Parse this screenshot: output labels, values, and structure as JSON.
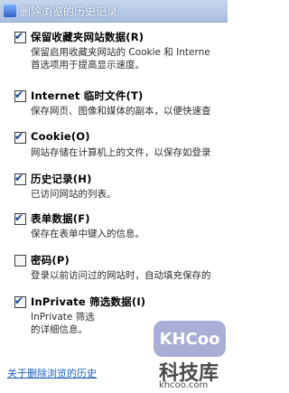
{
  "window": {
    "title": "删除浏览的历史记录"
  },
  "items": [
    {
      "label": "保留收藏夹网站数据(R)",
      "checked": true,
      "description": [
        "保留启用收藏夹网站的 Cookie 和 Interne",
        "首选项用于提高显示速度。"
      ]
    },
    {
      "label": "Internet 临时文件(T)",
      "checked": true,
      "description": [
        "保存网页、图像和媒体的副本，以便快速查"
      ]
    },
    {
      "label": "Cookie(O)",
      "checked": true,
      "description": [
        "网站存储在计算机上的文件，以保存如登录"
      ]
    },
    {
      "label": "历史记录(H)",
      "checked": true,
      "description": [
        "已访问网站的列表。"
      ]
    },
    {
      "label": "表单数据(F)",
      "checked": true,
      "description": [
        "保存在表单中键入的信息。"
      ]
    },
    {
      "label": "密码(P)",
      "checked": false,
      "description": [
        "登录以前访问过的网站时，自动填充保存的"
      ]
    },
    {
      "label": "InPrivate 筛选数据(I)",
      "checked": true,
      "description": [
        "InPrivate 筛选",
        "的详细信息。"
      ]
    }
  ],
  "link": {
    "text": "关于删除浏览的历史"
  },
  "watermark": {
    "logo_text": "KHCoo",
    "title": "科技库",
    "url": "khcoo.com"
  },
  "colors": {
    "titlebar": "#b8cbe6",
    "link": "#1a5fbf",
    "check": "#143f8f"
  }
}
